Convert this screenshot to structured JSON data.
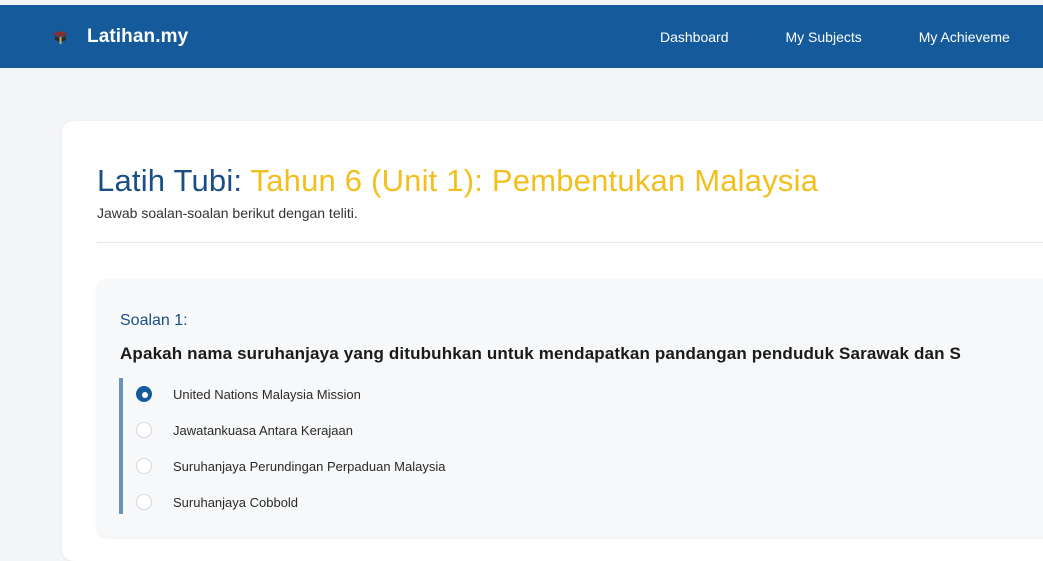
{
  "navbar": {
    "brand": "Latihan.my",
    "brand_icon": "graduation-cap-icon",
    "links": [
      "Dashboard",
      "My Subjects",
      "My Achieveme"
    ]
  },
  "page": {
    "title_prefix": "Latih Tubi:",
    "title_topic": "Tahun 6 (Unit 1): Pembentukan Malaysia",
    "subtitle": "Jawab soalan-soalan berikut dengan teliti."
  },
  "question": {
    "number": "Soalan 1:",
    "text": "Apakah nama suruhanjaya yang ditubuhkan untuk mendapatkan pandangan penduduk Sarawak dan S",
    "options": [
      {
        "label": "United Nations Malaysia Mission",
        "selected": true
      },
      {
        "label": "Jawatankuasa Antara Kerajaan",
        "selected": false
      },
      {
        "label": "Suruhanjaya Perundingan Perpaduan Malaysia",
        "selected": false
      },
      {
        "label": "Suruhanjaya Cobbold",
        "selected": false
      }
    ]
  },
  "colors": {
    "navbar": "#155a9b",
    "title_prefix": "#1b4f84",
    "title_topic": "#f2bf1f",
    "options_bar": "#6a93b7"
  }
}
